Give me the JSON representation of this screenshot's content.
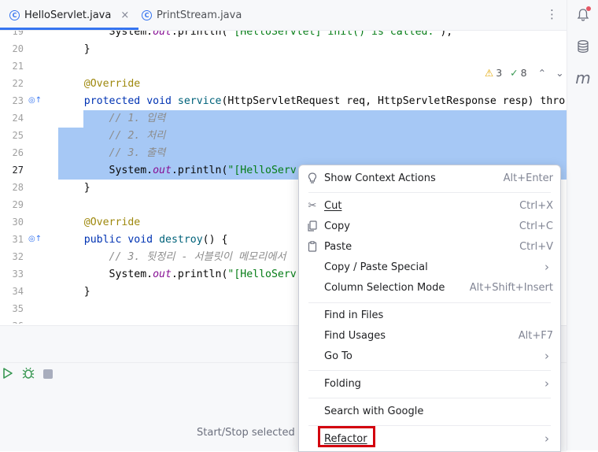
{
  "tabs": [
    {
      "label": "HelloServlet.java",
      "active": true,
      "icon": "class-icon"
    },
    {
      "label": "PrintStream.java",
      "active": false,
      "icon": "class-icon"
    }
  ],
  "tab_close": "×",
  "tab_more": "⋮",
  "right_strip": {
    "icons": [
      "notifications-icon",
      "database-icon",
      "maven-icon"
    ],
    "maven_letter": "m"
  },
  "inspections": {
    "warnings": "3",
    "passed": "8"
  },
  "editor": {
    "lines": [
      {
        "num": "19",
        "text": "        System.out.println(\"[HelloServlet] init() is called.\");"
      },
      {
        "num": "20",
        "text": "    }"
      },
      {
        "num": "21",
        "text": ""
      },
      {
        "num": "22",
        "text": "    @Override"
      },
      {
        "num": "23",
        "text": "    protected void service(HttpServletRequest req, HttpServletResponse resp) thro"
      },
      {
        "num": "24",
        "text": "        // 1. 입력"
      },
      {
        "num": "25",
        "text": "        // 2. 처리"
      },
      {
        "num": "26",
        "text": "        // 3. 출력"
      },
      {
        "num": "27",
        "text": "        System.out.println(\"[HelloServ"
      },
      {
        "num": "28",
        "text": "    }"
      },
      {
        "num": "29",
        "text": ""
      },
      {
        "num": "30",
        "text": "    @Override"
      },
      {
        "num": "31",
        "text": "    public void destroy() {"
      },
      {
        "num": "32",
        "text": "        // 3. 뒷정리 - 서블릿이 메모리에서"
      },
      {
        "num": "33",
        "text": "        System.out.println(\"[HelloServ"
      },
      {
        "num": "34",
        "text": "    }"
      },
      {
        "num": "35",
        "text": ""
      },
      {
        "num": "36",
        "text": ""
      }
    ],
    "current_line": "27",
    "selected_lines": [
      "24",
      "25",
      "26",
      "27"
    ],
    "override_marker_lines": [
      "23",
      "31"
    ]
  },
  "bottom_panel": {
    "status": "Start/Stop selected c",
    "toolbar_icons": [
      "run-icon",
      "debug-icon",
      "stop-icon"
    ]
  },
  "context_menu": {
    "items": [
      {
        "label": "Show Context Actions",
        "shortcut": "Alt+Enter",
        "icon": "bulb-icon"
      },
      {
        "label": "Cut",
        "shortcut": "Ctrl+X",
        "icon": "scissors-icon"
      },
      {
        "label": "Copy",
        "shortcut": "Ctrl+C",
        "icon": "copy-icon"
      },
      {
        "label": "Paste",
        "shortcut": "Ctrl+V",
        "icon": "paste-icon"
      },
      {
        "label": "Copy / Paste Special",
        "submenu": true
      },
      {
        "label": "Column Selection Mode",
        "shortcut": "Alt+Shift+Insert"
      },
      {
        "label": "Find in Files"
      },
      {
        "label": "Find Usages",
        "shortcut": "Alt+F7"
      },
      {
        "label": "Go To",
        "submenu": true
      },
      {
        "label": "Folding",
        "submenu": true
      },
      {
        "label": "Search with Google"
      },
      {
        "label": "Refactor",
        "submenu": true,
        "highlighted": true
      }
    ]
  },
  "colors": {
    "accent": "#3574f0",
    "selection": "#a6c8f5",
    "highlight_box": "#d3000e",
    "warning": "#e2a600",
    "ok": "#369650"
  }
}
